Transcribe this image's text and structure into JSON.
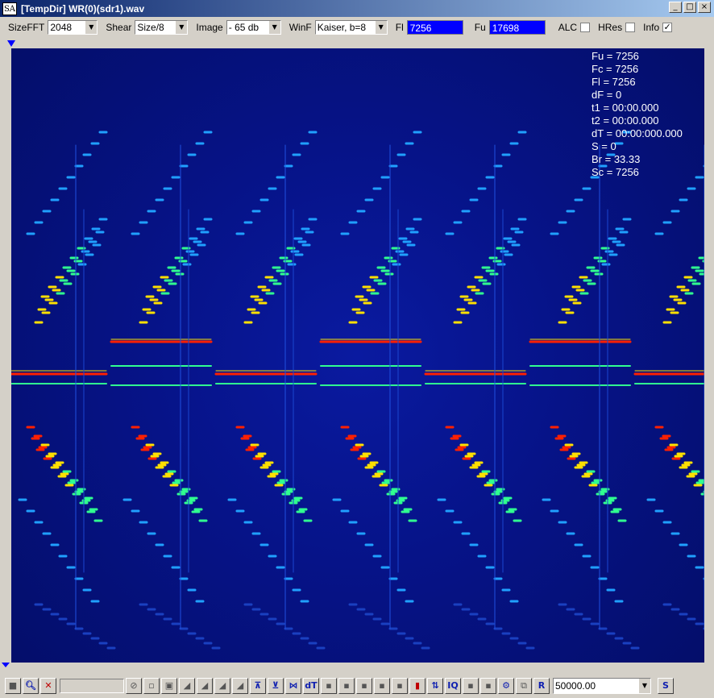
{
  "window": {
    "icon_text": "SA",
    "title": "[TempDir] WR(0)(sdr1).wav",
    "minimize": "_",
    "maximize": "□",
    "close": "×"
  },
  "toolbar": {
    "sizefft_label": "SizeFFT",
    "sizefft_value": "2048",
    "shear_label": "Shear",
    "shear_value": "Size/8",
    "image_label": "Image",
    "image_value": "- 65 db",
    "winf_label": "WinF",
    "winf_value": "Kaiser, b=8",
    "fl_label": "Fl",
    "fl_value": "7256",
    "fu_label": "Fu",
    "fu_value": "17698",
    "alc_label": "ALC",
    "alc_checked": false,
    "hres_label": "HRes",
    "hres_checked": false,
    "info_label": "Info",
    "info_checked": true,
    "check_mark": "✓"
  },
  "info_panel": {
    "fu": "Fu = 7256",
    "fc": "Fc = 7256",
    "fl": "Fl = 7256",
    "df": "dF = 0",
    "t1": "t1 = 00:00.000",
    "t2": "t2 = 00:00.000",
    "dt": "dT = 00:00:000.000",
    "s": "S = 0",
    "br": "Br = 33.33",
    "sc": "Sc = 7256"
  },
  "bottom": {
    "rate_value": "50000.00",
    "dt_label": "dT",
    "iq_label": "IQ",
    "r_label": "R",
    "s_label": "S"
  },
  "colors": {
    "background": "#061388",
    "trace_hot": "#ff2000",
    "trace_warm": "#ffe000",
    "trace_mid": "#30ff90",
    "trace_cool": "#20a0ff"
  }
}
